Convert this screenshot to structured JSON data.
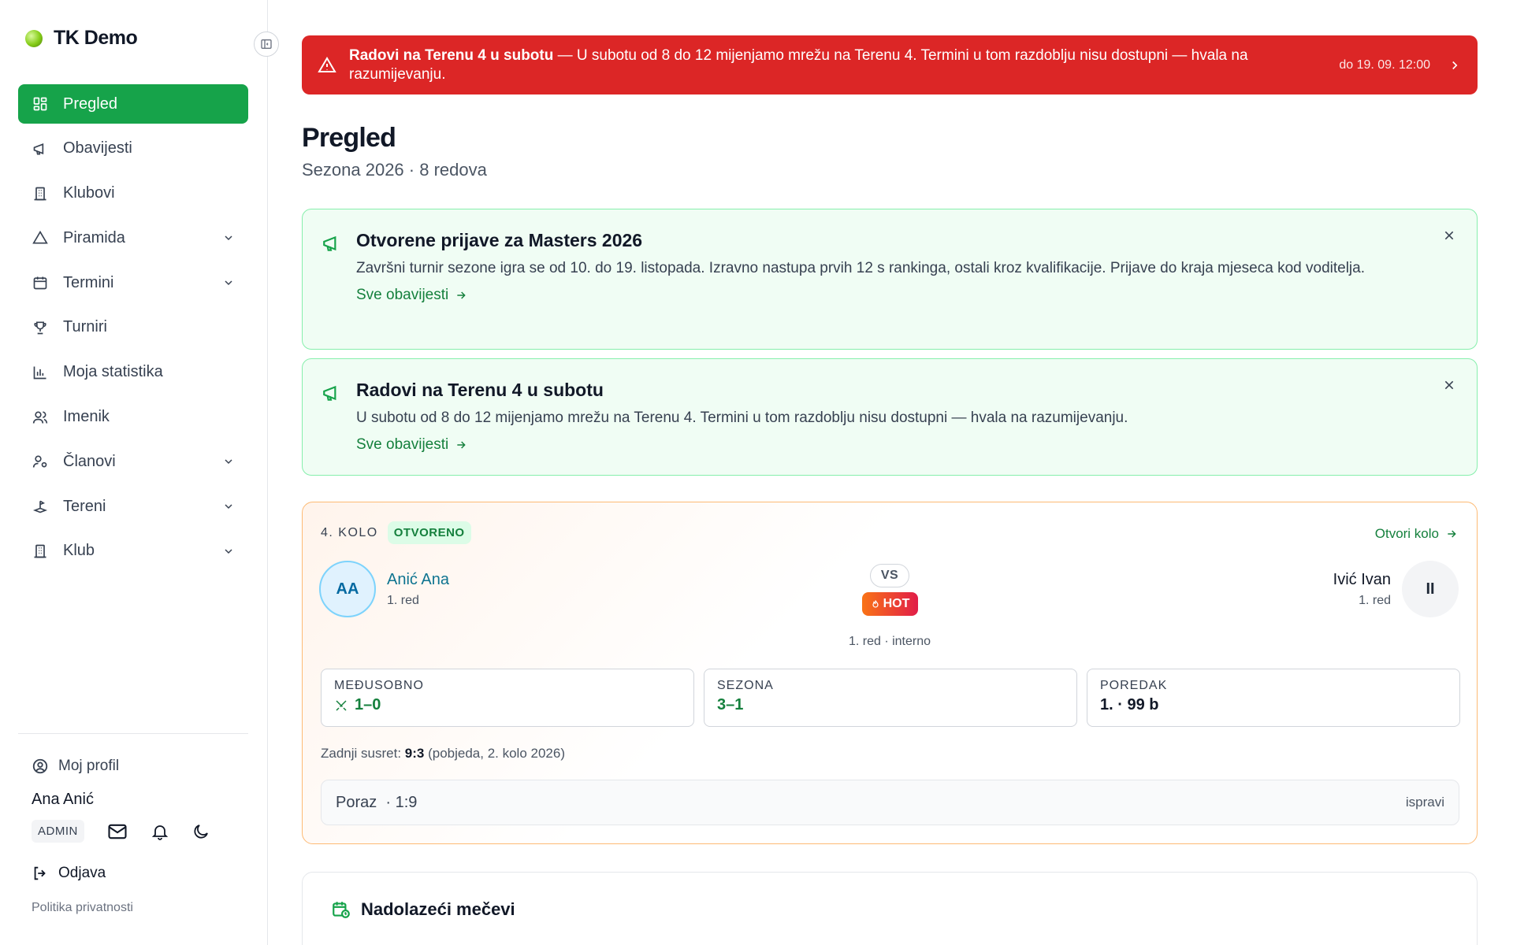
{
  "app": {
    "name": "TK Demo"
  },
  "sidebar": {
    "items": [
      {
        "label": "Pregled",
        "icon": "dashboard-grid-icon",
        "active": true
      },
      {
        "label": "Obavijesti",
        "icon": "megaphone-icon"
      },
      {
        "label": "Klubovi",
        "icon": "building-icon"
      },
      {
        "label": "Piramida",
        "icon": "triangle-icon",
        "expandable": true
      },
      {
        "label": "Termini",
        "icon": "calendar-icon",
        "expandable": true
      },
      {
        "label": "Turniri",
        "icon": "trophy-icon"
      },
      {
        "label": "Moja statistika",
        "icon": "bar-chart-icon"
      },
      {
        "label": "Imenik",
        "icon": "users-icon"
      },
      {
        "label": "Članovi",
        "icon": "user-settings-icon",
        "expandable": true
      },
      {
        "label": "Tereni",
        "icon": "court-icon",
        "expandable": true
      },
      {
        "label": "Klub",
        "icon": "building-icon",
        "expandable": true
      }
    ],
    "footer": {
      "profile_label": "Moj profil",
      "user_name": "Ana Anić",
      "role": "ADMIN",
      "logout_label": "Odjava",
      "privacy_label": "Politika privatnosti"
    }
  },
  "alert": {
    "title": "Radovi na Terenu 4 u subotu",
    "separator": " — ",
    "message": "U subotu od 8 do 12 mijenjamo mrežu na Terenu 4. Termini u tom razdoblju nisu dostupni — hvala na razumijevanju.",
    "until": "do 19. 09. 12:00"
  },
  "page": {
    "title": "Pregled",
    "subtitle": "Sezona 2026 · 8 redova"
  },
  "notices": [
    {
      "title": "Otvorene prijave za Masters 2026",
      "body": "Završni turnir sezone igra se od 10. do 19. listopada. Izravno nastupa prvih 12 s rankinga, ostali kroz kvalifikacije. Prijave do kraja mjeseca kod voditelja.",
      "link": "Sve obavijesti"
    },
    {
      "title": "Radovi na Terenu 4 u subotu",
      "body": "U subotu od 8 do 12 mijenjamo mrežu na Terenu 4. Termini u tom razdoblju nisu dostupni — hvala na razumijevanju.",
      "link": "Sve obavijesti"
    }
  ],
  "round": {
    "label": "4. KOLO",
    "status": "OTVORENO",
    "open_link": "Otvori kolo",
    "player_left": {
      "initials": "AA",
      "name": "Anić Ana",
      "row": "1. red"
    },
    "player_right": {
      "initials": "II",
      "name": "Ivić Ivan",
      "row": "1. red"
    },
    "vs": "VS",
    "hot": "HOT",
    "match_info": "1. red · interno",
    "stats": [
      {
        "label": "MEĐUSOBNO",
        "value": "1–0"
      },
      {
        "label": "SEZONA",
        "value": "3–1"
      },
      {
        "label": "POREDAK",
        "value": "1. · 99 b"
      }
    ],
    "last_match": {
      "prefix": "Zadnji susret:",
      "score": "9:3",
      "detail": "(pobjeda, 2. kolo 2026)"
    },
    "result": {
      "text": "Poraz  · 1:9",
      "fix_label": "ispravi"
    }
  },
  "upcoming": {
    "title": "Nadolazeći mečevi"
  },
  "colors": {
    "primary": "#16a34a",
    "alert": "#dc2626",
    "notice_bg": "#f0fdf4",
    "accent_orange": "#fdba74"
  }
}
